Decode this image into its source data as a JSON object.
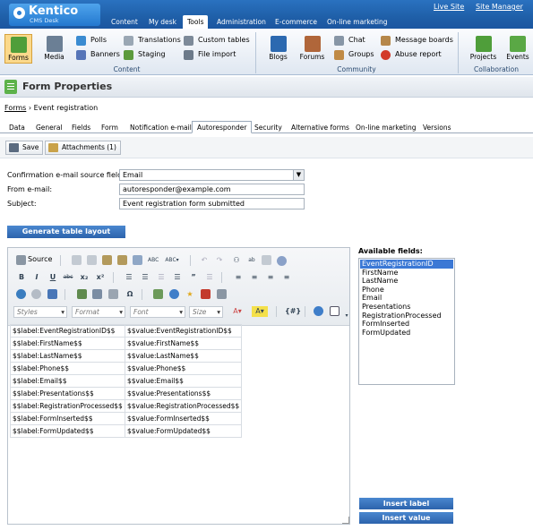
{
  "header": {
    "logo_title": "Kentico",
    "logo_subtitle": "CMS Desk",
    "links": [
      "Live Site",
      "Site Manager"
    ],
    "tabs": [
      "Content",
      "My desk",
      "Tools",
      "Administration",
      "E-commerce",
      "On-line marketing"
    ],
    "active_tab": "Tools"
  },
  "ribbon": {
    "content": {
      "label": "Content",
      "big": [
        "Forms",
        "Media"
      ],
      "small": [
        "Polls",
        "Banners",
        "Translations",
        "Staging",
        "Custom tables",
        "File import"
      ]
    },
    "community": {
      "label": "Community",
      "big": [
        "Blogs",
        "Forums"
      ],
      "small": [
        "Chat",
        "Groups",
        "Message boards",
        "Abuse report"
      ]
    },
    "collaboration": {
      "label": "Collaboration",
      "big": [
        "Projects",
        "Events"
      ]
    }
  },
  "page": {
    "title": "Form Properties",
    "breadcrumb_root": "Forms",
    "breadcrumb_current": "Event registration"
  },
  "tabs": [
    "Data",
    "General",
    "Fields",
    "Form",
    "Notification e-mail",
    "Autoresponder",
    "Security",
    "Alternative forms",
    "On-line marketing",
    "Versions"
  ],
  "active_tab": "Autoresponder",
  "actions": {
    "save": "Save",
    "attachments": "Attachments (1)"
  },
  "form": {
    "source_label": "Confirmation e-mail source field:",
    "source_value": "Email",
    "from_label": "From e-mail:",
    "from_value": "autoresponder@example.com",
    "subject_label": "Subject:",
    "subject_value": "Event registration form submitted"
  },
  "generate_button": "Generate table layout",
  "editor": {
    "source_label": "Source",
    "combos": {
      "styles": "Styles",
      "format": "Format",
      "font": "Font",
      "size": "Size"
    },
    "rows": [
      [
        "$$label:EventRegistrationID$$",
        "$$value:EventRegistrationID$$"
      ],
      [
        "$$label:FirstName$$",
        "$$value:FirstName$$"
      ],
      [
        "$$label:LastName$$",
        "$$value:LastName$$"
      ],
      [
        "$$label:Phone$$",
        "$$value:Phone$$"
      ],
      [
        "$$label:Email$$",
        "$$value:Email$$"
      ],
      [
        "$$label:Presentations$$",
        "$$value:Presentations$$"
      ],
      [
        "$$label:RegistrationProcessed$$",
        "$$value:RegistrationProcessed$$"
      ],
      [
        "$$label:FormInserted$$",
        "$$value:FormInserted$$"
      ],
      [
        "$$label:FormUpdated$$",
        "$$value:FormUpdated$$"
      ]
    ]
  },
  "available_fields": {
    "label": "Available fields:",
    "items": [
      "EventRegistrationID",
      "FirstName",
      "LastName",
      "Phone",
      "Email",
      "Presentations",
      "RegistrationProcessed",
      "FormInserted",
      "FormUpdated"
    ],
    "selected": "EventRegistrationID",
    "insert_label": "Insert label",
    "insert_value": "Insert value"
  }
}
